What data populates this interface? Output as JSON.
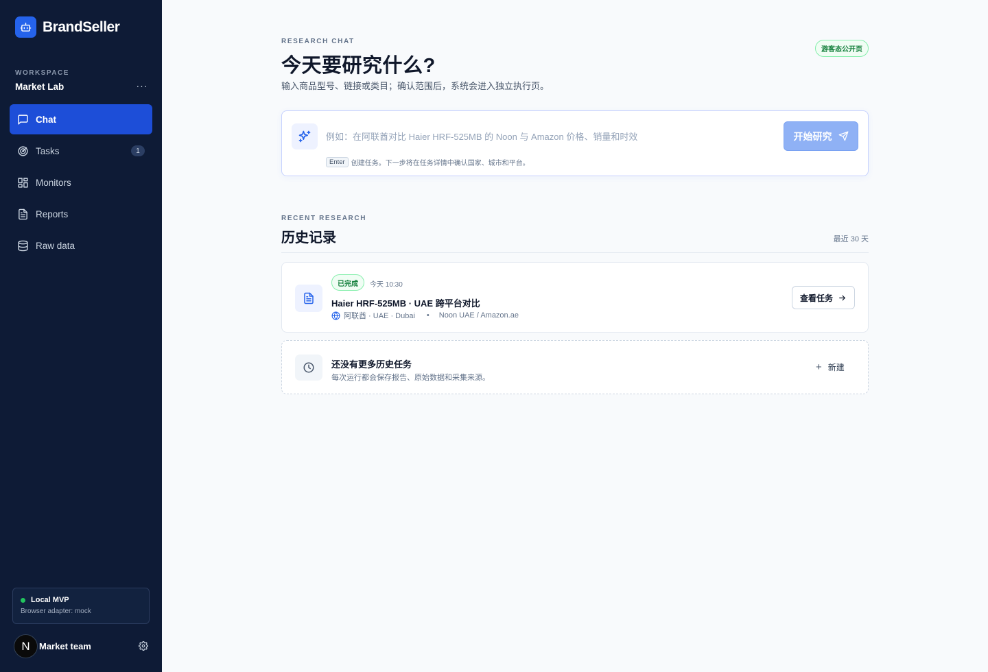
{
  "brand": {
    "name": "BrandSeller"
  },
  "workspace": {
    "label": "WORKSPACE",
    "name": "Market Lab",
    "more": "···"
  },
  "nav": {
    "items": [
      {
        "label": "Chat",
        "icon": "chat-icon"
      },
      {
        "label": "Tasks",
        "icon": "target-icon",
        "badge": "1"
      },
      {
        "label": "Monitors",
        "icon": "grid-icon"
      },
      {
        "label": "Reports",
        "icon": "document-icon"
      },
      {
        "label": "Raw data",
        "icon": "database-icon"
      }
    ]
  },
  "status": {
    "title": "Local MVP",
    "subtitle": "Browser adapter: mock"
  },
  "user": {
    "initial": "N",
    "name": "Market team"
  },
  "hero": {
    "eyebrow": "RESEARCH CHAT",
    "title": "今天要研究什么?",
    "subtitle": "输入商品型号、链接或类目；确认范围后，系统会进入独立执行页。",
    "badge": "游客态公开页"
  },
  "composer": {
    "placeholder": "例如：在阿联酋对比 Haier HRF-525MB 的 Noon 与 Amazon 价格、销量和时效",
    "button_label": "开始研究",
    "hint_key": "Enter",
    "hint_text": "创建任务。下一步将在任务详情中确认国家、城市和平台。"
  },
  "recent": {
    "eyebrow": "RECENT RESEARCH",
    "title": "历史记录",
    "range": "最近 30 天",
    "tasks": [
      {
        "status": "已完成",
        "time": "今天 10:30",
        "title": "Haier HRF-525MB · UAE 跨平台对比",
        "location": "阿联酋 · UAE · Dubai",
        "separator": "•",
        "platforms": "Noon UAE / Amazon.ae",
        "action": "查看任务"
      }
    ],
    "empty": {
      "title": "还没有更多历史任务",
      "subtitle": "每次运行都会保存报告、原始数据和采集来源。",
      "action": "新建"
    }
  },
  "colors": {
    "sidebar": "#0e1b36",
    "accent": "#1d4ed8",
    "success": "#15803d",
    "button_disabled": "#8fb1f5"
  }
}
